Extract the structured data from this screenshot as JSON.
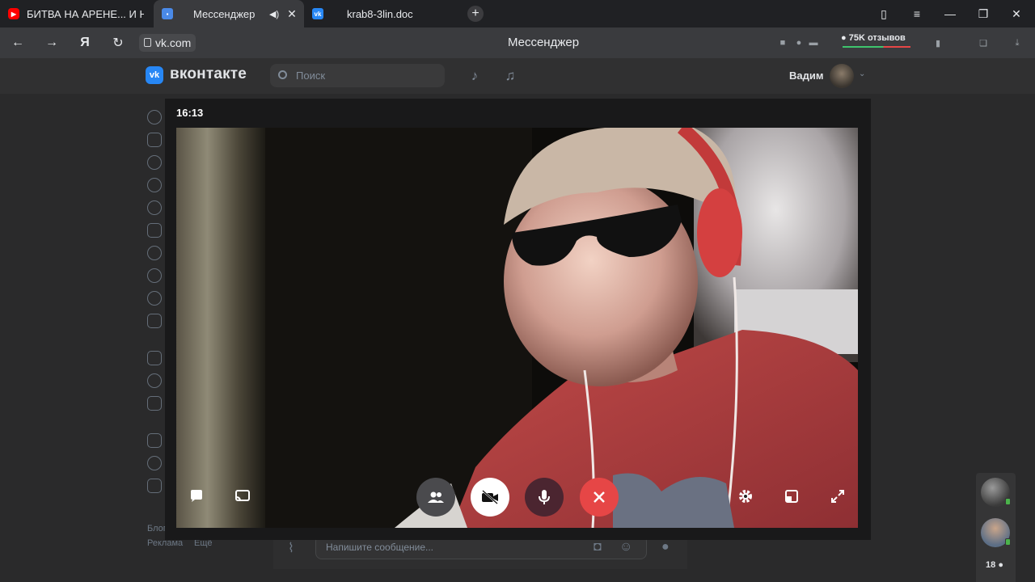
{
  "browser": {
    "tabs": [
      {
        "label": "БИТВА НА АРЕНЕ... И НЕ Т",
        "icon": "youtube-icon"
      },
      {
        "label": "Мессенджер",
        "icon": "vk-messenger-icon",
        "active": true
      },
      {
        "label": "krab8-3lin.doc",
        "icon": "vk-icon"
      }
    ],
    "url": "vk.com",
    "page_title": "Мессенджер",
    "reviews_label": "75K отзывов"
  },
  "vk": {
    "logo_text": "вконтакте",
    "search_placeholder": "Поиск",
    "user_name": "Вадим",
    "footer": {
      "blog": "Блог",
      "ads": "Реклама",
      "more": "Ещё"
    },
    "composer_placeholder": "Напишите сообщение..."
  },
  "call": {
    "timer": "16:13",
    "participants_count": "18",
    "controls": [
      "chat",
      "screen-share",
      "participants",
      "camera-off",
      "microphone",
      "end-call",
      "settings",
      "layout",
      "fullscreen"
    ]
  },
  "colors": {
    "end_call": "#e64646",
    "vk_blue": "#2787f5",
    "mic_button": "#4b2530"
  }
}
